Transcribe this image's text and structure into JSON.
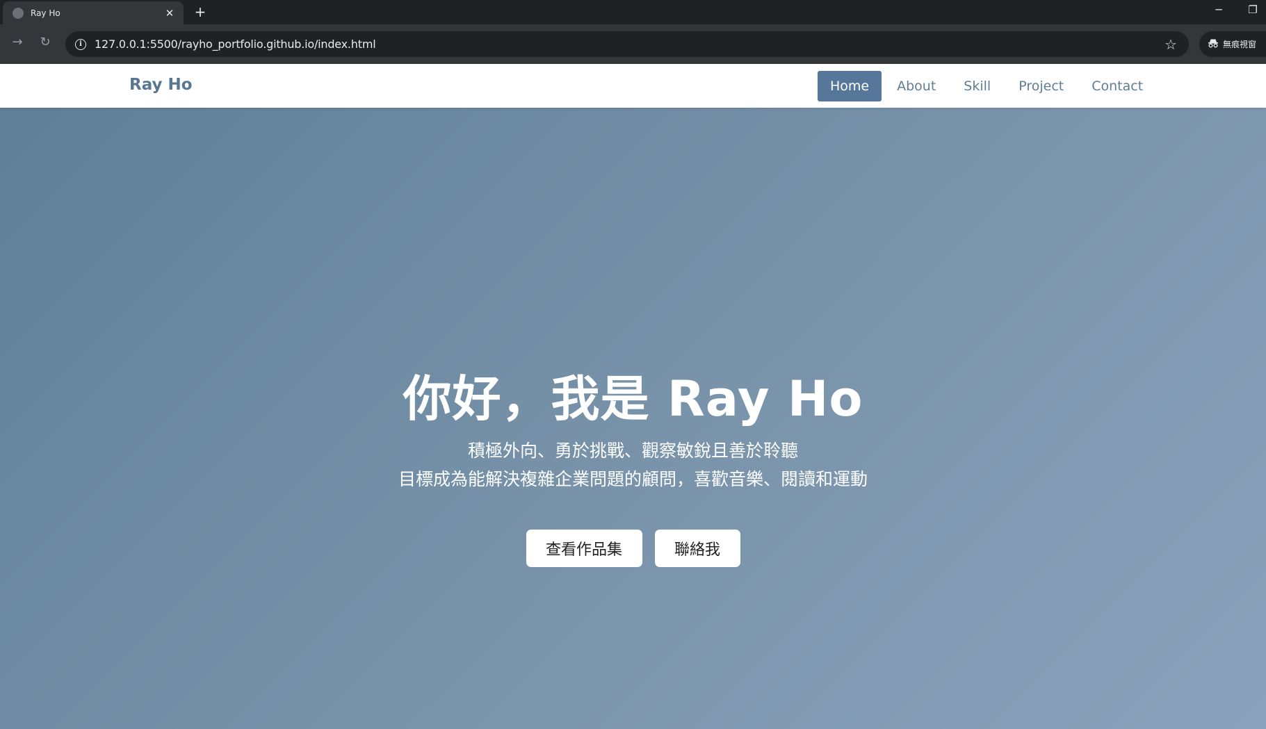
{
  "browser": {
    "tab_title": "Ray Ho",
    "new_tab": "+",
    "close": "✕",
    "minimize": "─",
    "restore": "❐",
    "back": "←",
    "forward": "→",
    "reload": "↻",
    "url": "127.0.0.1:5500/rayho_portfolio.github.io/index.html",
    "star": "☆",
    "incognito_label": "無痕視窗"
  },
  "navbar": {
    "brand": "Ray Ho",
    "links": [
      {
        "label": "Home",
        "active": true
      },
      {
        "label": "About"
      },
      {
        "label": "Skill"
      },
      {
        "label": "Project"
      },
      {
        "label": "Contact"
      }
    ]
  },
  "hero": {
    "title": "你好，我是 Ray Ho",
    "subtitle_line1": "積極外向、勇於挑戰、觀察敏銳且善於聆聽",
    "subtitle_line2": "目標成為能解決複雜企業問題的顧問，喜歡音樂、閱讀和運動",
    "cta_portfolio": "查看作品集",
    "cta_contact": "聯絡我"
  },
  "colors": {
    "chrome_dark": "#202124",
    "chrome_toolbar": "#35363a",
    "brand": "#5a7792",
    "nav_active_bg": "#56779a",
    "hero_gradient_start": "#5f7f98",
    "hero_gradient_end": "#8ca2bc"
  }
}
